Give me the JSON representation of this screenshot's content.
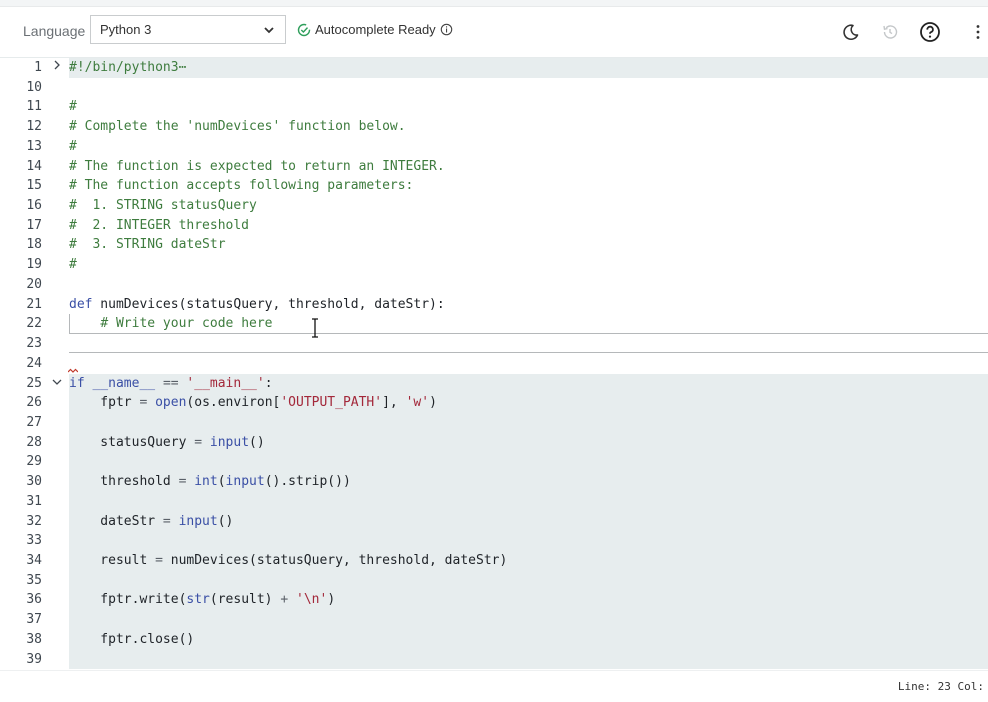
{
  "toolbar": {
    "language_label": "Language",
    "language_selected": "Python 3",
    "autocomplete_status": "Autocomplete Ready",
    "icons": [
      "check-circle-icon",
      "info-icon",
      "moon-icon",
      "history-icon",
      "help-icon",
      "more-vertical-icon"
    ]
  },
  "editor": {
    "lines": [
      {
        "num": "1",
        "fold": "collapsed",
        "text": "#!/bin/python3⋯"
      },
      {
        "num": "10",
        "text": ""
      },
      {
        "num": "11",
        "text": "#"
      },
      {
        "num": "12",
        "text": "# Complete the 'numDevices' function below."
      },
      {
        "num": "13",
        "text": "#"
      },
      {
        "num": "14",
        "text": "# The function is expected to return an INTEGER."
      },
      {
        "num": "15",
        "text": "# The function accepts following parameters:"
      },
      {
        "num": "16",
        "text": "#  1. STRING statusQuery"
      },
      {
        "num": "17",
        "text": "#  2. INTEGER threshold"
      },
      {
        "num": "18",
        "text": "#  3. STRING dateStr"
      },
      {
        "num": "19",
        "text": "#"
      },
      {
        "num": "20",
        "text": ""
      },
      {
        "num": "21",
        "text": "def numDevices(statusQuery, threshold, dateStr):"
      },
      {
        "num": "22",
        "text": "    # Write your code here"
      },
      {
        "num": "23",
        "text": ""
      },
      {
        "num": "24",
        "text": ""
      },
      {
        "num": "25",
        "fold": "expanded",
        "text": "if __name__ == '__main__':"
      },
      {
        "num": "26",
        "text": "    fptr = open(os.environ['OUTPUT_PATH'], 'w')"
      },
      {
        "num": "27",
        "text": ""
      },
      {
        "num": "28",
        "text": "    statusQuery = input()"
      },
      {
        "num": "29",
        "text": ""
      },
      {
        "num": "30",
        "text": "    threshold = int(input().strip())"
      },
      {
        "num": "31",
        "text": ""
      },
      {
        "num": "32",
        "text": "    dateStr = input()"
      },
      {
        "num": "33",
        "text": ""
      },
      {
        "num": "34",
        "text": "    result = numDevices(statusQuery, threshold, dateStr)"
      },
      {
        "num": "35",
        "text": ""
      },
      {
        "num": "36",
        "text": "    fptr.write(str(result) + '\\n')"
      },
      {
        "num": "37",
        "text": ""
      },
      {
        "num": "38",
        "text": "    fptr.close()"
      },
      {
        "num": "39",
        "text": ""
      }
    ]
  },
  "statusbar": {
    "position_text": "Line: 23 Col:"
  },
  "colors": {
    "comment": "#3e7c3e",
    "keyword": "#3a4fa5",
    "string": "#a3283a",
    "highlight_bg": "#e7edee",
    "success": "#2e9e5b"
  }
}
